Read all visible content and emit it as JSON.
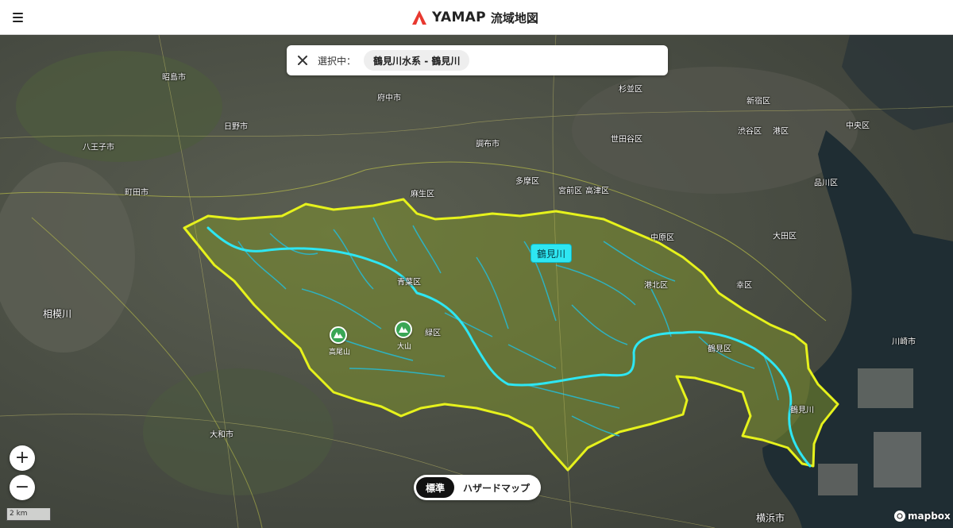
{
  "header": {
    "menu_icon": "hamburger-menu-icon",
    "brand_name": "YAMAP",
    "brand_sub": "流域地図",
    "brand_color": "#e8382f"
  },
  "selection": {
    "label": "選択中：",
    "value": "鶴見川水系 - 鶴見川"
  },
  "river_tag": "鶴見川",
  "mountains": [
    {
      "label": "高尾山"
    },
    {
      "label": "大山"
    }
  ],
  "place_labels": [
    "昭島市",
    "府中市",
    "杉並区",
    "新宿区",
    "日野市",
    "調布市",
    "世田谷区",
    "渋谷区",
    "港区",
    "中央区",
    "八王子市",
    "町田市",
    "麻生区",
    "多摩区",
    "宮前区",
    "高津区",
    "品川区",
    "中原区",
    "大田区",
    "鶴見川",
    "青葉区",
    "緑区",
    "港北区",
    "幸区",
    "相模川",
    "鶴見区",
    "川崎市",
    "大和市",
    "横浜市",
    "都筑区"
  ],
  "zoom": {
    "in": "+",
    "out": "−"
  },
  "scale": "2 km",
  "modes": {
    "standard": "標準",
    "hazard": "ハザードマップ"
  },
  "attribution": "mapbox",
  "colors": {
    "watershed_outline": "#e6f21c",
    "river": "#2ee6f2",
    "tributary": "#2bb6c8",
    "accent": "#e8382f"
  }
}
